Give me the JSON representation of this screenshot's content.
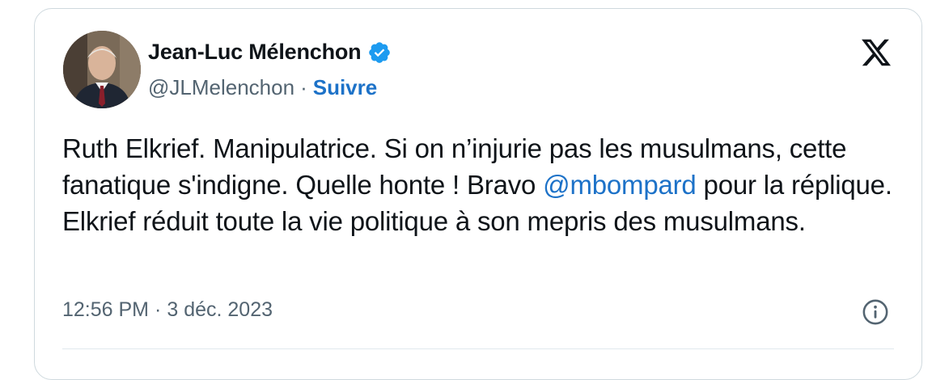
{
  "author": {
    "name": "Jean-Luc Mélenchon",
    "handle": "@JLMelenchon",
    "separator": "·",
    "follow_label": "Suivre",
    "verified_icon": "verified-badge-icon",
    "verified_color": "#1d9bf0"
  },
  "tweet": {
    "text_before_mention": "Ruth Elkrief. Manipulatrice. Si on n’injurie pas les musulmans, cette fanatique s'indigne. Quelle honte ! Bravo ",
    "mention": "@mbompard",
    "text_after_mention": " pour la réplique. Elkrief réduit toute la vie politique à son mepris des musulmans."
  },
  "meta": {
    "time": "12:56 PM",
    "separator": "·",
    "date": "3 déc. 2023"
  },
  "icons": {
    "platform": "x-logo-icon",
    "info": "info-icon"
  },
  "colors": {
    "link": "#1d72c8",
    "text": "#0f1419",
    "secondary": "#536471",
    "border": "#cfd9de"
  }
}
